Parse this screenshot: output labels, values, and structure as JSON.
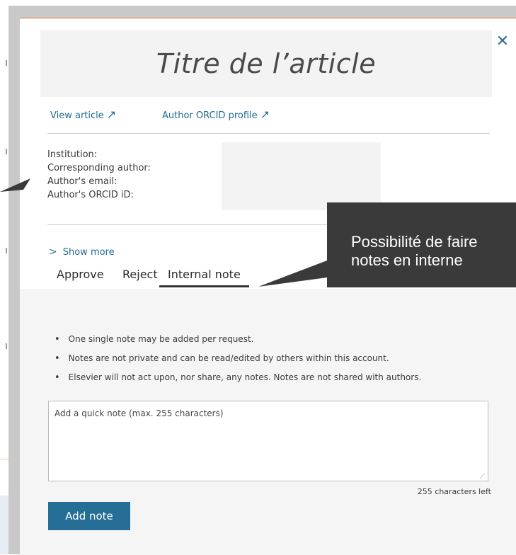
{
  "modal": {
    "article_title": "Titre de l’article",
    "close_icon": "close-icon",
    "links": {
      "view_article": "View article",
      "author_orcid_profile": "Author ORCID profile",
      "arrow_icon": "↗"
    },
    "meta": {
      "institution_label": "Institution:",
      "corresponding_author_label": "Corresponding author:",
      "author_email_label": "Author's email:",
      "author_orcid_label": "Author's ORCID iD:"
    },
    "show_more": "Show more",
    "tabs": {
      "approve": "Approve",
      "reject": "Reject",
      "internal_note": "Internal note",
      "active": "internal_note"
    },
    "info_bullets": [
      "One single note may be added per request.",
      "Notes are not private and can be read/edited by others within this account.",
      "Elsevier will not act upon, nor share, any notes. Notes are not shared with authors."
    ],
    "note": {
      "placeholder": "Add a quick note (max. 255 characters)",
      "value": "",
      "chars_left": "255 characters left"
    },
    "add_note_label": "Add note"
  },
  "callout": {
    "text": "Possibilité de faire\nnotes en interne"
  },
  "colors": {
    "accent": "#256e95",
    "link": "#1f6a93",
    "modal_top_border": "#e9711c",
    "callout_bg": "#3a3a3a"
  }
}
